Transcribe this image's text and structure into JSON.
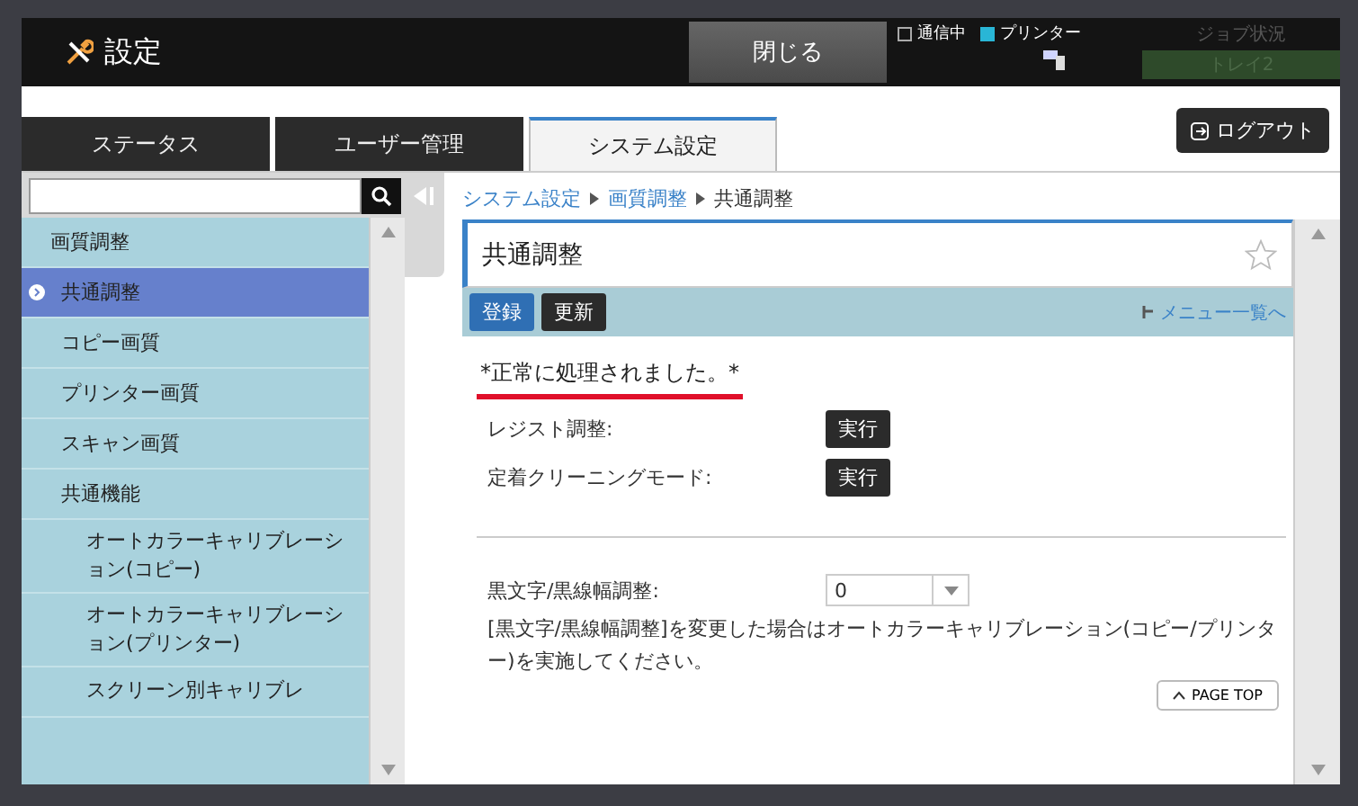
{
  "header": {
    "title": "設定",
    "close_button": "閉じる",
    "indicators": [
      {
        "label": "通信中",
        "checked": false
      },
      {
        "label": "プリンター",
        "checked": true
      }
    ],
    "job_status": {
      "label": "ジョブ状況",
      "tray": "トレイ2",
      "disabled": true
    }
  },
  "tabs": [
    {
      "label": "ステータス",
      "selected": false
    },
    {
      "label": "ユーザー管理",
      "selected": false
    },
    {
      "label": "システム設定",
      "selected": true
    }
  ],
  "logout_button": "ログアウト",
  "sidebar": {
    "items": [
      {
        "label": "画質調整",
        "selected": false,
        "children": [
          {
            "label": "共通調整",
            "selected": true
          },
          {
            "label": "コピー画質",
            "selected": false
          },
          {
            "label": "プリンター画質",
            "selected": false
          },
          {
            "label": "スキャン画質",
            "selected": false
          },
          {
            "label": "共通機能",
            "selected": false,
            "children": [
              {
                "label": "オートカラーキャリブレーション(コピー)",
                "selected": false
              },
              {
                "label": "オートカラーキャリブレーション(プリンター)",
                "selected": false
              },
              {
                "label": "スクリーン別キャリブレ",
                "selected": false
              }
            ]
          }
        ]
      }
    ]
  },
  "breadcrumb": [
    {
      "label": "システム設定",
      "link": true
    },
    {
      "label": "画質調整",
      "link": true
    },
    {
      "label": "共通調整",
      "link": false
    }
  ],
  "page": {
    "title": "共通調整",
    "favorite": false,
    "register_button": "登録",
    "update_button": "更新",
    "menu_link": "メニュー一覧へ",
    "message": "*正常に処理されました。*",
    "actions": [
      {
        "label": "レジスト調整:",
        "button": "実行"
      },
      {
        "label": "定着クリーニングモード:",
        "button": "実行"
      }
    ],
    "setting": {
      "label": "黒文字/黒線幅調整:",
      "value": "0"
    },
    "note": "[黒文字/黒線幅調整]を変更した場合はオートカラーキャリブレーション(コピー/プリンター)を実施してください。",
    "page_top": "PAGE TOP"
  }
}
